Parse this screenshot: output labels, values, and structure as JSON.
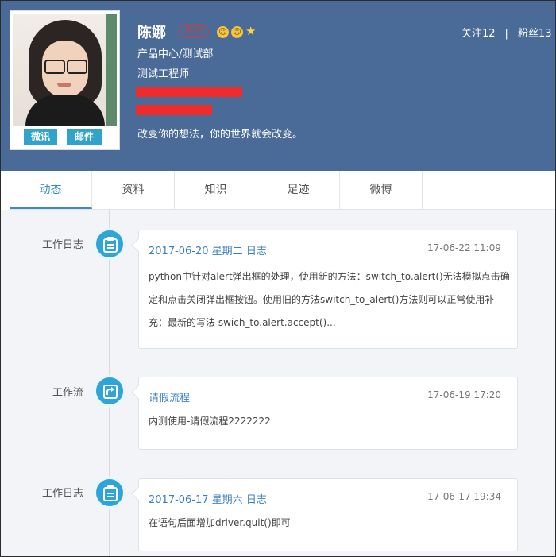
{
  "profile": {
    "name": "陈娜",
    "status": "在线",
    "department": "产品中心/测试部",
    "job_title": "测试工程师",
    "motto": "改变你的想法，你的世界就会改变。",
    "actions": {
      "wechat_label": "微讯",
      "mail_label": "邮件"
    },
    "following_label": "关注12",
    "separator": "|",
    "followers_label": "粉丝13"
  },
  "tabs": [
    {
      "label": "动态",
      "active": true
    },
    {
      "label": "资料",
      "active": false
    },
    {
      "label": "知识",
      "active": false
    },
    {
      "label": "足迹",
      "active": false
    },
    {
      "label": "微博",
      "active": false
    }
  ],
  "timeline": [
    {
      "category": "工作日志",
      "icon": "clipboard-icon",
      "title": "2017-06-20 星期二 日志",
      "time": "17-06-22 11:09",
      "body": "python中针对alert弹出框的处理，使用新的方法：switch_to.alert()无法模拟点击确定和点击关闭弹出框按钮。使用旧的方法switch_to_alert()方法则可以正常使用补充：最新的写法 swich_to.alert.accept()..."
    },
    {
      "category": "工作流",
      "icon": "share-arrow-icon",
      "title": "请假流程",
      "time": "17-06-19 17:20",
      "body": "内测使用-请假流程2222222"
    },
    {
      "category": "工作日志",
      "icon": "clipboard-icon",
      "title": "2017-06-17 星期六 日志",
      "time": "17-06-17 19:34",
      "body": "在语句后面增加driver.quit()即可"
    }
  ],
  "colors": {
    "header_bg": "#4a6a97",
    "accent": "#2ea4d9",
    "link": "#3a7fc0",
    "redaction": "#ef2b2b"
  }
}
